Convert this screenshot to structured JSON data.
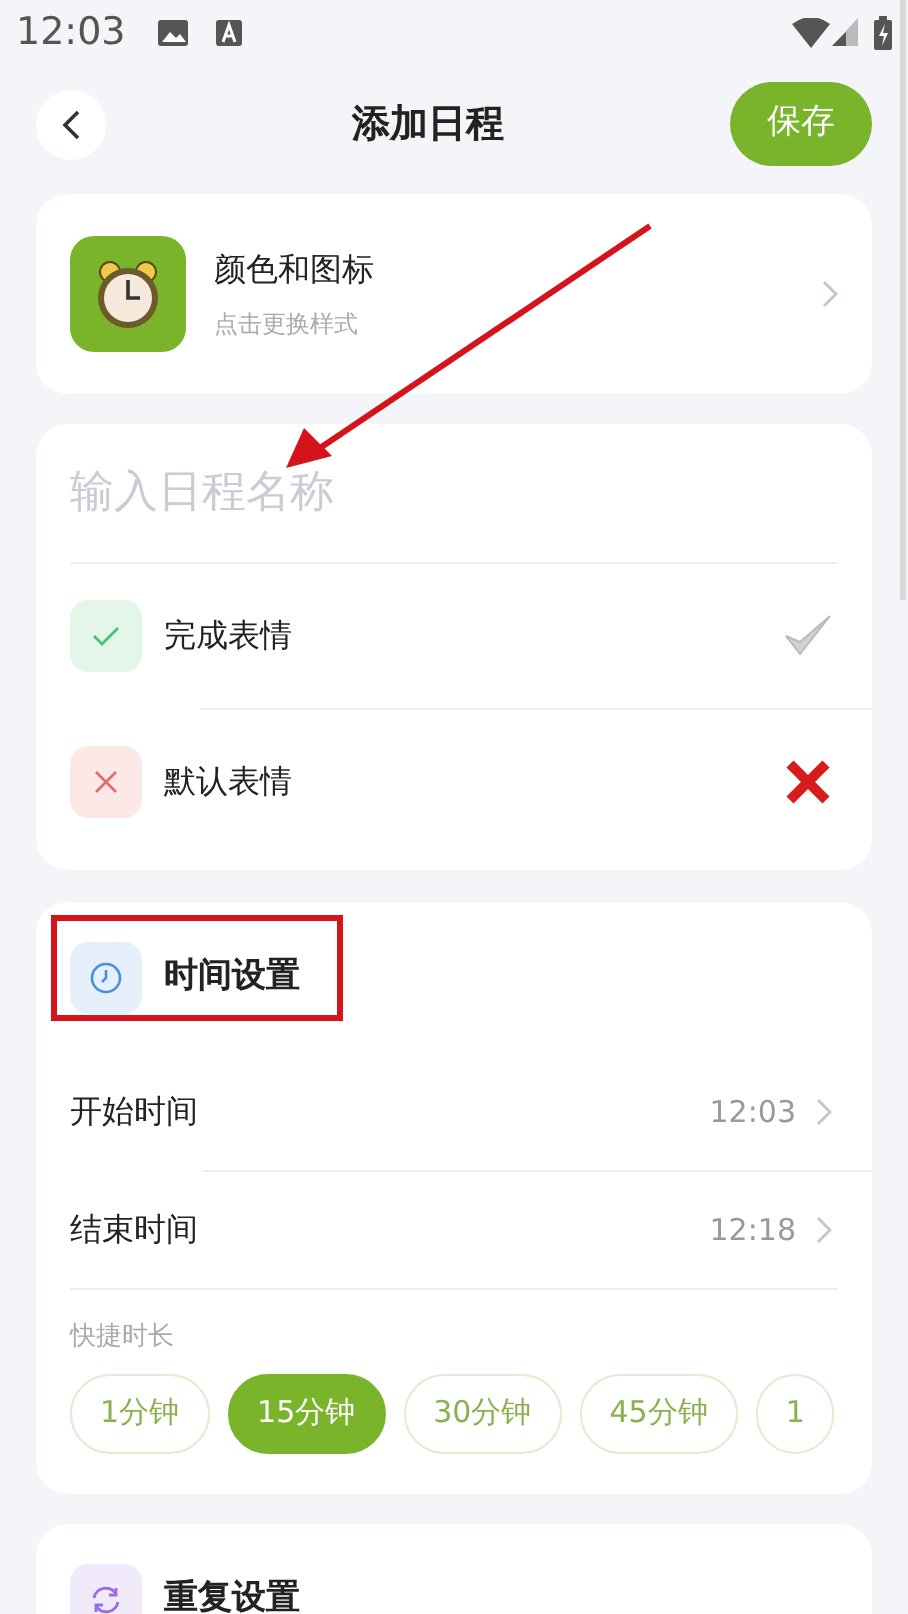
{
  "status_bar": {
    "time": "12:03"
  },
  "header": {
    "title": "添加日程",
    "save": "保存"
  },
  "style_card": {
    "title": "颜色和图标",
    "subtitle": "点击更换样式"
  },
  "name_input": {
    "placeholder": "输入日程名称"
  },
  "expressions": [
    {
      "kind": "done",
      "label": "完成表情"
    },
    {
      "kind": "default",
      "label": "默认表情"
    }
  ],
  "time_settings": {
    "title": "时间设置",
    "rows": [
      {
        "label": "开始时间",
        "value": "12:03"
      },
      {
        "label": "结束时间",
        "value": "12:18"
      }
    ],
    "quick_label": "快捷时长",
    "chips": [
      {
        "label": "1分钟",
        "selected": false
      },
      {
        "label": "15分钟",
        "selected": true
      },
      {
        "label": "30分钟",
        "selected": false
      },
      {
        "label": "45分钟",
        "selected": false
      },
      {
        "label": "1",
        "selected": false
      }
    ]
  },
  "repeat_settings": {
    "title": "重复设置"
  }
}
